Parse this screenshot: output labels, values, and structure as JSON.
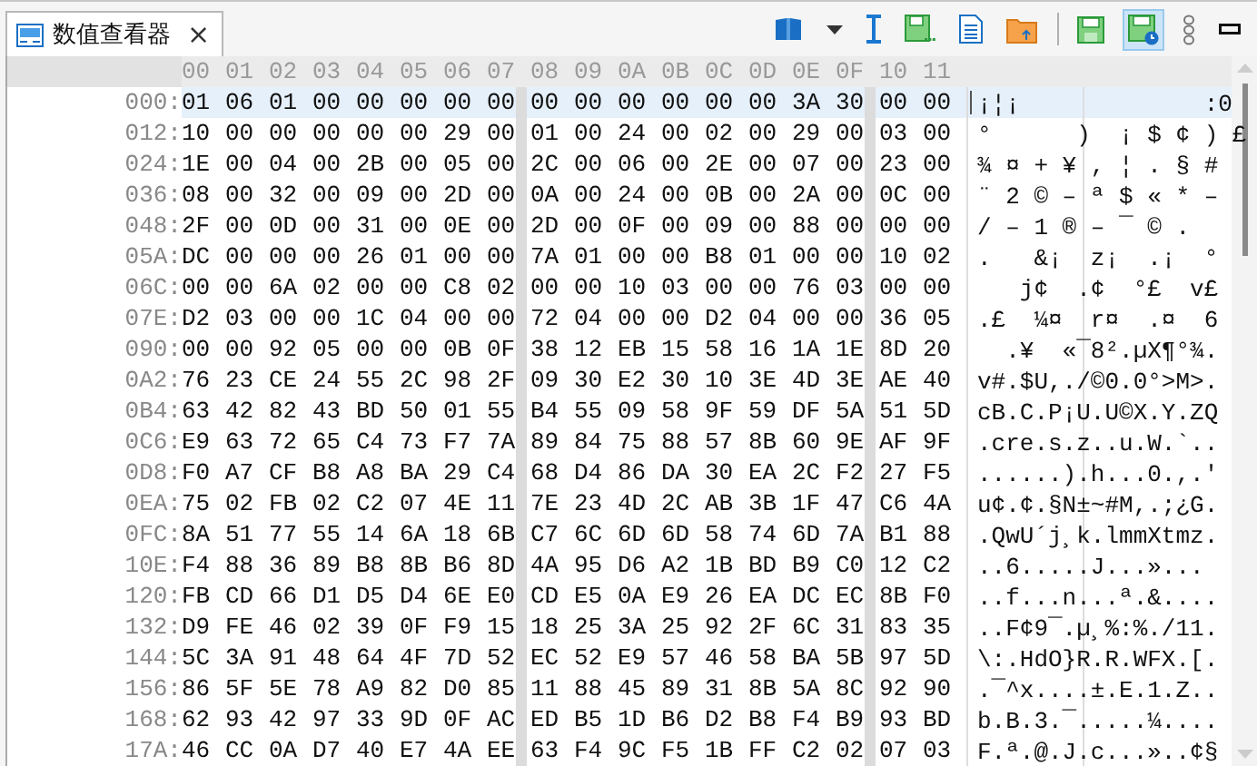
{
  "tab": {
    "label": "数值查看器",
    "close": "×",
    "selected": true
  },
  "toolbar": [
    {
      "kind": "book"
    },
    {
      "kind": "caret"
    },
    {
      "kind": "cursor"
    },
    {
      "kind": "savemore"
    },
    {
      "kind": "document"
    },
    {
      "kind": "folder"
    },
    {
      "kind": "separator"
    },
    {
      "kind": "save"
    },
    {
      "kind": "saveclock",
      "pressed": true
    },
    {
      "kind": "chain"
    },
    {
      "kind": "minimize"
    }
  ],
  "columns": [
    "00",
    "01",
    "02",
    "03",
    "04",
    "05",
    "06",
    "07",
    "08",
    "09",
    "0A",
    "0B",
    "0C",
    "0D",
    "0E",
    "0F",
    "10",
    "11"
  ],
  "rows": [
    {
      "offset": "000:",
      "bytes": [
        "01",
        "06",
        "01",
        "00",
        "00",
        "00",
        "00",
        "00",
        "00",
        "00",
        "00",
        "00",
        "00",
        "00",
        "3A",
        "30",
        "00",
        "00"
      ],
      "text": "¡¦¡             :0",
      "selected": true
    },
    {
      "offset": "012:",
      "bytes": [
        "10",
        "00",
        "00",
        "00",
        "00",
        "00",
        "29",
        "00",
        "01",
        "00",
        "24",
        "00",
        "02",
        "00",
        "29",
        "00",
        "03",
        "00"
      ],
      "text": "°      )  ¡ $ ¢ ) £",
      "selected": false
    },
    {
      "offset": "024:",
      "bytes": [
        "1E",
        "00",
        "04",
        "00",
        "2B",
        "00",
        "05",
        "00",
        "2C",
        "00",
        "06",
        "00",
        "2E",
        "00",
        "07",
        "00",
        "23",
        "00"
      ],
      "text": "¾ ¤ + ¥ , ¦ . § #",
      "selected": false
    },
    {
      "offset": "036:",
      "bytes": [
        "08",
        "00",
        "32",
        "00",
        "09",
        "00",
        "2D",
        "00",
        "0A",
        "00",
        "24",
        "00",
        "0B",
        "00",
        "2A",
        "00",
        "0C",
        "00"
      ],
      "text": "¨ 2 © – ª $ « * –",
      "selected": false
    },
    {
      "offset": "048:",
      "bytes": [
        "2F",
        "00",
        "0D",
        "00",
        "31",
        "00",
        "0E",
        "00",
        "2D",
        "00",
        "0F",
        "00",
        "09",
        "00",
        "88",
        "00",
        "00",
        "00"
      ],
      "text": "/ – 1 ® – ¯ © .",
      "selected": false
    },
    {
      "offset": "05A:",
      "bytes": [
        "DC",
        "00",
        "00",
        "00",
        "26",
        "01",
        "00",
        "00",
        "7A",
        "01",
        "00",
        "00",
        "B8",
        "01",
        "00",
        "00",
        "10",
        "02"
      ],
      "text": ".   &¡  z¡  .¡  °",
      "selected": false
    },
    {
      "offset": "06C:",
      "bytes": [
        "00",
        "00",
        "6A",
        "02",
        "00",
        "00",
        "C8",
        "02",
        "00",
        "00",
        "10",
        "03",
        "00",
        "00",
        "76",
        "03",
        "00",
        "00"
      ],
      "text": "   j¢  .¢  °£  v£",
      "selected": false
    },
    {
      "offset": "07E:",
      "bytes": [
        "D2",
        "03",
        "00",
        "00",
        "1C",
        "04",
        "00",
        "00",
        "72",
        "04",
        "00",
        "00",
        "D2",
        "04",
        "00",
        "00",
        "36",
        "05"
      ],
      "text": ".£  ¼¤  r¤  .¤  6",
      "selected": false
    },
    {
      "offset": "090:",
      "bytes": [
        "00",
        "00",
        "92",
        "05",
        "00",
        "00",
        "0B",
        "0F",
        "38",
        "12",
        "EB",
        "15",
        "58",
        "16",
        "1A",
        "1E",
        "8D",
        "20"
      ],
      "text": "  .¥  «¯8².µX¶°¾.",
      "selected": false
    },
    {
      "offset": "0A2:",
      "bytes": [
        "76",
        "23",
        "CE",
        "24",
        "55",
        "2C",
        "98",
        "2F",
        "09",
        "30",
        "E2",
        "30",
        "10",
        "3E",
        "4D",
        "3E",
        "AE",
        "40"
      ],
      "text": "v#.$U,./©0.0°>M>.",
      "selected": false
    },
    {
      "offset": "0B4:",
      "bytes": [
        "63",
        "42",
        "82",
        "43",
        "BD",
        "50",
        "01",
        "55",
        "B4",
        "55",
        "09",
        "58",
        "9F",
        "59",
        "DF",
        "5A",
        "51",
        "5D"
      ],
      "text": "cB.C.P¡U.U©X.Y.ZQ",
      "selected": false
    },
    {
      "offset": "0C6:",
      "bytes": [
        "E9",
        "63",
        "72",
        "65",
        "C4",
        "73",
        "F7",
        "7A",
        "89",
        "84",
        "75",
        "88",
        "57",
        "8B",
        "60",
        "9E",
        "AF",
        "9F"
      ],
      "text": ".cre.s.z..u.W.`..",
      "selected": false
    },
    {
      "offset": "0D8:",
      "bytes": [
        "F0",
        "A7",
        "CF",
        "B8",
        "A8",
        "BA",
        "29",
        "C4",
        "68",
        "D4",
        "86",
        "DA",
        "30",
        "EA",
        "2C",
        "F2",
        "27",
        "F5"
      ],
      "text": "......).h...0.,.'",
      "selected": false
    },
    {
      "offset": "0EA:",
      "bytes": [
        "75",
        "02",
        "FB",
        "02",
        "C2",
        "07",
        "4E",
        "11",
        "7E",
        "23",
        "4D",
        "2C",
        "AB",
        "3B",
        "1F",
        "47",
        "C6",
        "4A"
      ],
      "text": "u¢.¢.§N±~#M,.;¿G.",
      "selected": false
    },
    {
      "offset": "0FC:",
      "bytes": [
        "8A",
        "51",
        "77",
        "55",
        "14",
        "6A",
        "18",
        "6B",
        "C7",
        "6C",
        "6D",
        "6D",
        "58",
        "74",
        "6D",
        "7A",
        "B1",
        "88"
      ],
      "text": ".QwU´j¸k.lmmXtmz.",
      "selected": false
    },
    {
      "offset": "10E:",
      "bytes": [
        "F4",
        "88",
        "36",
        "89",
        "B8",
        "8B",
        "B6",
        "8D",
        "4A",
        "95",
        "D6",
        "A2",
        "1B",
        "BD",
        "B9",
        "C0",
        "12",
        "C2"
      ],
      "text": "..6.....J...»...",
      "selected": false
    },
    {
      "offset": "120:",
      "bytes": [
        "FB",
        "CD",
        "66",
        "D1",
        "D5",
        "D4",
        "6E",
        "E0",
        "CD",
        "E5",
        "0A",
        "E9",
        "26",
        "EA",
        "DC",
        "EC",
        "8B",
        "F0"
      ],
      "text": "..f...n...ª.&....",
      "selected": false
    },
    {
      "offset": "132:",
      "bytes": [
        "D9",
        "FE",
        "46",
        "02",
        "39",
        "0F",
        "F9",
        "15",
        "18",
        "25",
        "3A",
        "25",
        "92",
        "2F",
        "6C",
        "31",
        "83",
        "35"
      ],
      "text": "..F¢9¯.µ¸%:%./11.",
      "selected": false
    },
    {
      "offset": "144:",
      "bytes": [
        "5C",
        "3A",
        "91",
        "48",
        "64",
        "4F",
        "7D",
        "52",
        "EC",
        "52",
        "E9",
        "57",
        "46",
        "58",
        "BA",
        "5B",
        "97",
        "5D"
      ],
      "text": "\\:.HdO}R.R.WFX.[.",
      "selected": false
    },
    {
      "offset": "156:",
      "bytes": [
        "86",
        "5F",
        "5E",
        "78",
        "A9",
        "82",
        "D0",
        "85",
        "11",
        "88",
        "45",
        "89",
        "31",
        "8B",
        "5A",
        "8C",
        "92",
        "90"
      ],
      "text": ".¯^x....±.E.1.Z..",
      "selected": false
    },
    {
      "offset": "168:",
      "bytes": [
        "62",
        "93",
        "42",
        "97",
        "33",
        "9D",
        "0F",
        "AC",
        "ED",
        "B5",
        "1D",
        "B6",
        "D2",
        "B8",
        "F4",
        "B9",
        "93",
        "BD"
      ],
      "text": "b.B.3.¯.....¼....",
      "selected": false
    },
    {
      "offset": "17A:",
      "bytes": [
        "46",
        "CC",
        "0A",
        "D7",
        "40",
        "E7",
        "4A",
        "EE",
        "63",
        "F4",
        "9C",
        "F5",
        "1B",
        "FF",
        "C2",
        "02",
        "07",
        "03"
      ],
      "text": "F.ª.@.J.c...»..¢§",
      "selected": false
    }
  ]
}
